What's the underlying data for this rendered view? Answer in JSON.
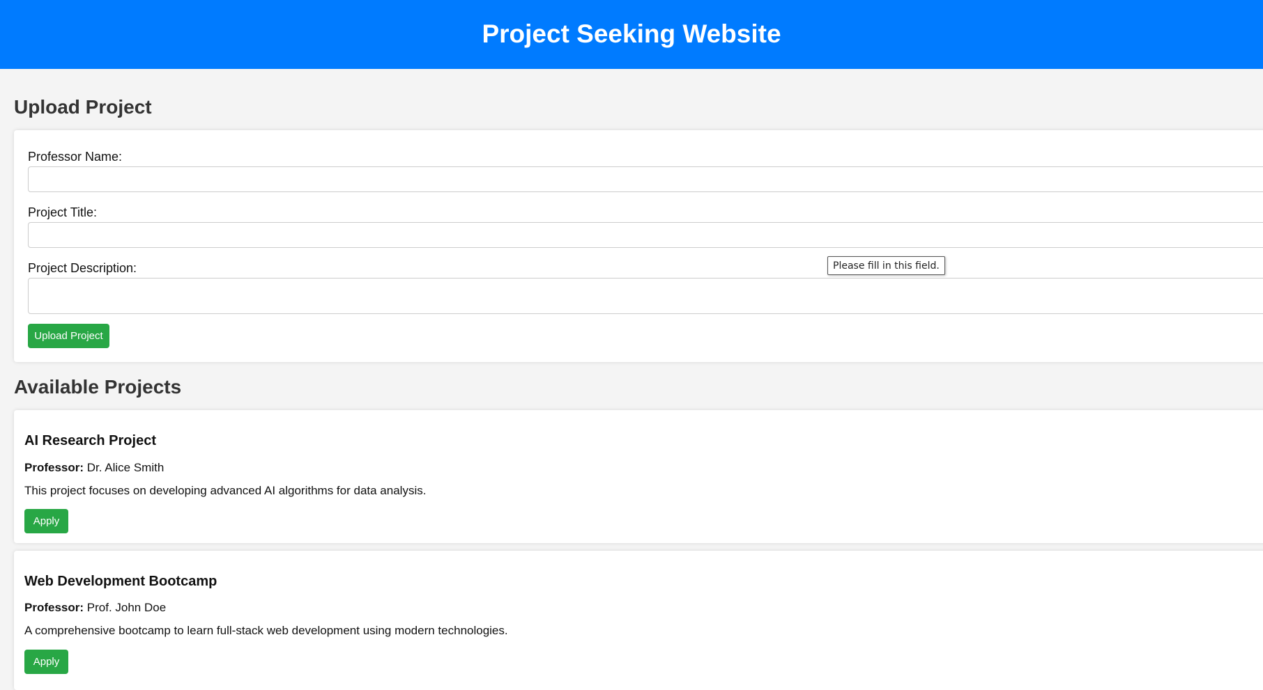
{
  "header": {
    "title": "Project Seeking Website"
  },
  "upload_section": {
    "heading": "Upload Project",
    "professor_label": "Professor Name:",
    "professor_value": "",
    "title_label": "Project Title:",
    "title_value": "",
    "description_label": "Project Description:",
    "description_value": "",
    "submit_label": "Upload Project",
    "validation_tooltip": "Please fill in this field."
  },
  "projects_section": {
    "heading": "Available Projects",
    "professor_prefix": "Professor:",
    "projects": [
      {
        "title": "AI Research Project",
        "professor": "Dr. Alice Smith",
        "description": "This project focuses on developing advanced AI algorithms for data analysis.",
        "apply_label": "Apply"
      },
      {
        "title": "Web Development Bootcamp",
        "professor": "Prof. John Doe",
        "description": "A comprehensive bootcamp to learn full-stack web development using modern technologies.",
        "apply_label": "Apply"
      }
    ]
  },
  "colors": {
    "header_bg": "#007bff",
    "button_bg": "#28a745",
    "page_bg": "#f4f4f4"
  }
}
